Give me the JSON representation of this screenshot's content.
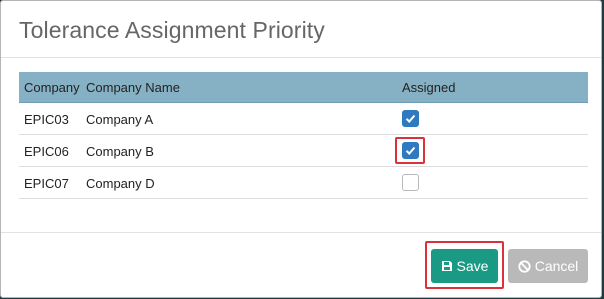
{
  "dialog": {
    "title": "Tolerance Assignment Priority"
  },
  "table": {
    "columns": [
      "Company",
      "Company Name",
      "Assigned"
    ],
    "rows": [
      {
        "company": "EPIC03",
        "company_name": "Company A",
        "assigned": true
      },
      {
        "company": "EPIC06",
        "company_name": "Company B",
        "assigned": true
      },
      {
        "company": "EPIC07",
        "company_name": "Company D",
        "assigned": false
      }
    ]
  },
  "footer": {
    "save_label": "Save",
    "cancel_label": "Cancel"
  },
  "colors": {
    "header_bg": "#86b1c5",
    "save_bg": "#1a9a84",
    "cancel_bg": "#b9b9b9",
    "checkbox_checked": "#2f79c0",
    "highlight": "#d9323a"
  },
  "icons": {
    "save": "floppy-disk-icon",
    "cancel": "ban-icon",
    "check": "check-icon"
  }
}
